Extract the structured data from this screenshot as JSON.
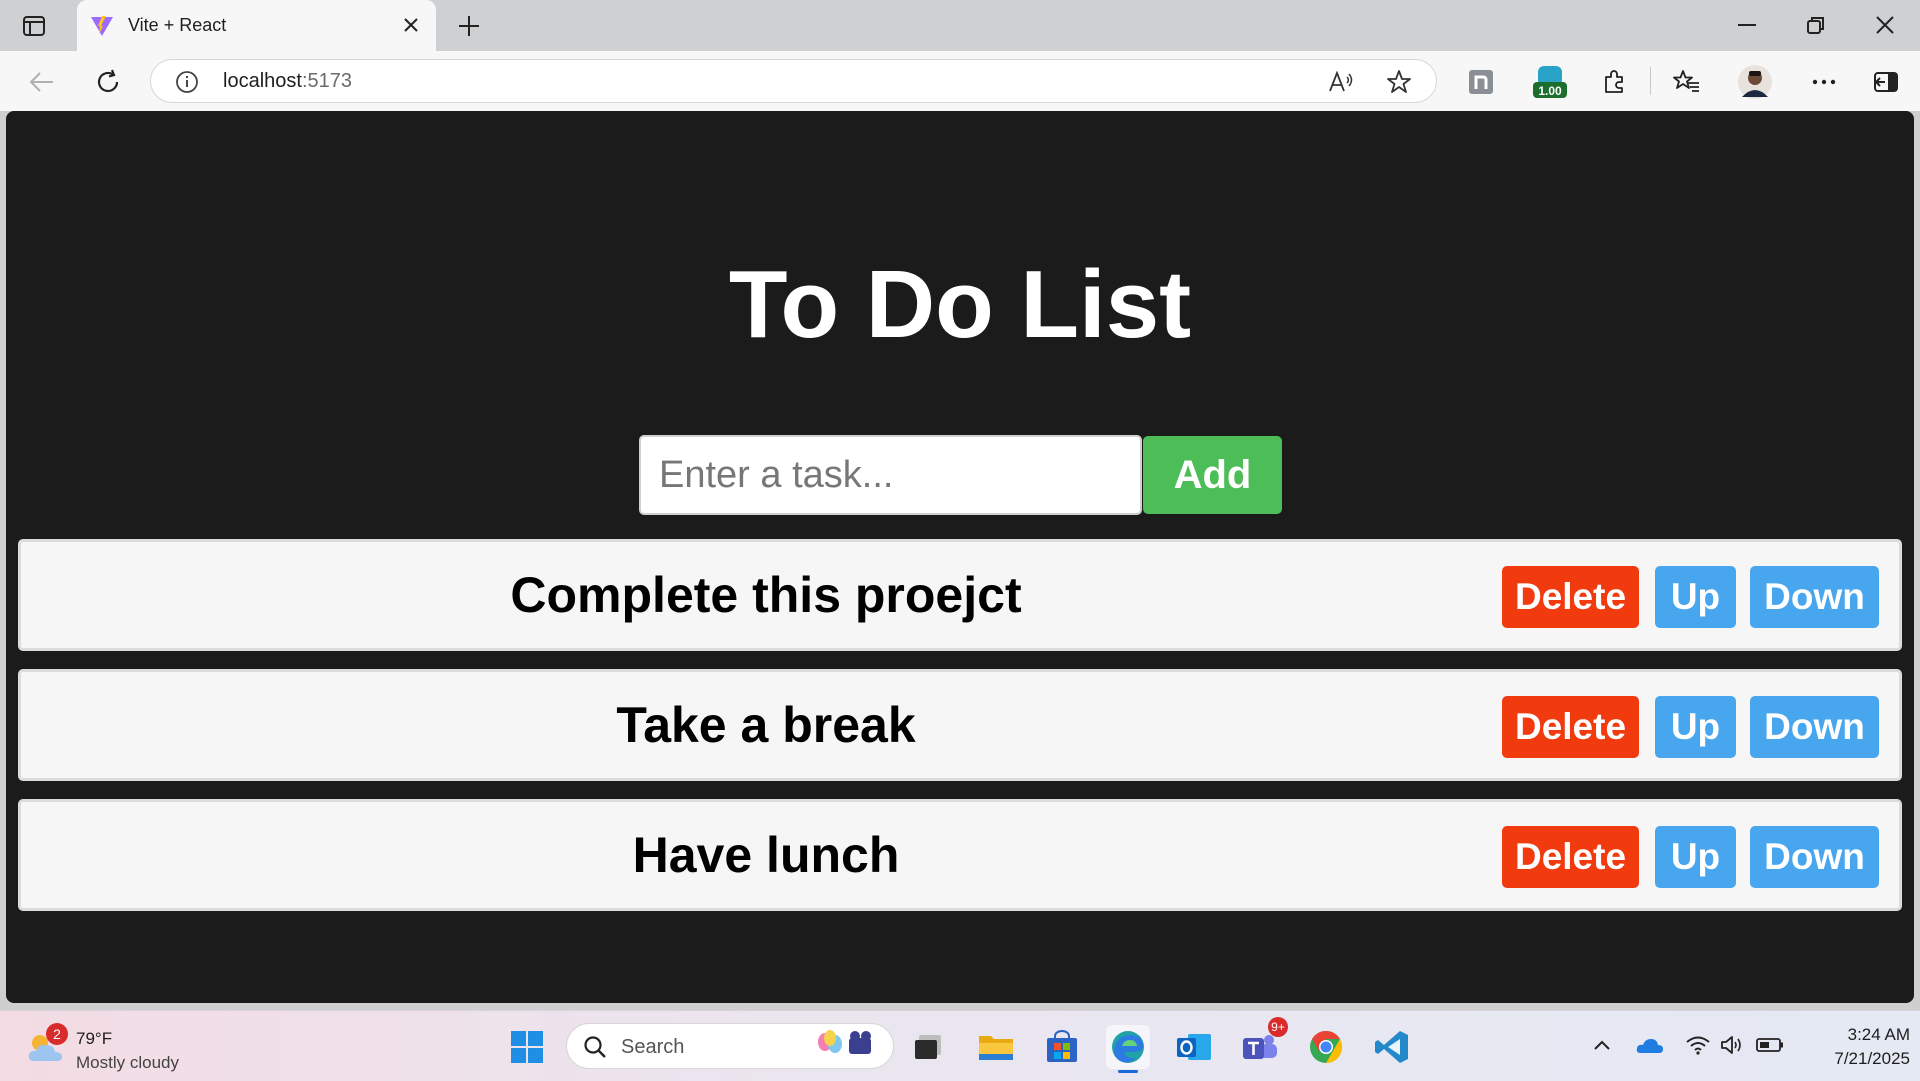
{
  "browser": {
    "tab_title": "Vite + React",
    "url_host": "localhost",
    "url_port": ":5173",
    "extension_badge": "1.00"
  },
  "app": {
    "title": "To Do List",
    "input": {
      "placeholder": "Enter a task...",
      "value": ""
    },
    "add_label": "Add",
    "tasks": [
      {
        "text": "Complete this proejct",
        "delete_label": "Delete",
        "up_label": "Up",
        "down_label": "Down"
      },
      {
        "text": "Take a break",
        "delete_label": "Delete",
        "up_label": "Up",
        "down_label": "Down"
      },
      {
        "text": "Have lunch",
        "delete_label": "Delete",
        "up_label": "Up",
        "down_label": "Down"
      }
    ],
    "colors": {
      "background": "#1b1b1c",
      "add": "#4cbd57",
      "delete": "#f23a0f",
      "move": "#48a6ef",
      "task_bg": "#f6f6f6"
    }
  },
  "taskbar": {
    "weather": {
      "alert_count": "2",
      "temp": "79°F",
      "condition": "Mostly cloudy"
    },
    "search_label": "Search",
    "teams_badge": "9+",
    "time": "3:24 AM",
    "date": "7/21/2025",
    "icons": [
      "windows-start-icon",
      "task-view-icon",
      "file-explorer-icon",
      "store-icon",
      "edge-icon",
      "outlook-icon",
      "teams-icon",
      "chrome-icon",
      "vscode-icon"
    ]
  }
}
